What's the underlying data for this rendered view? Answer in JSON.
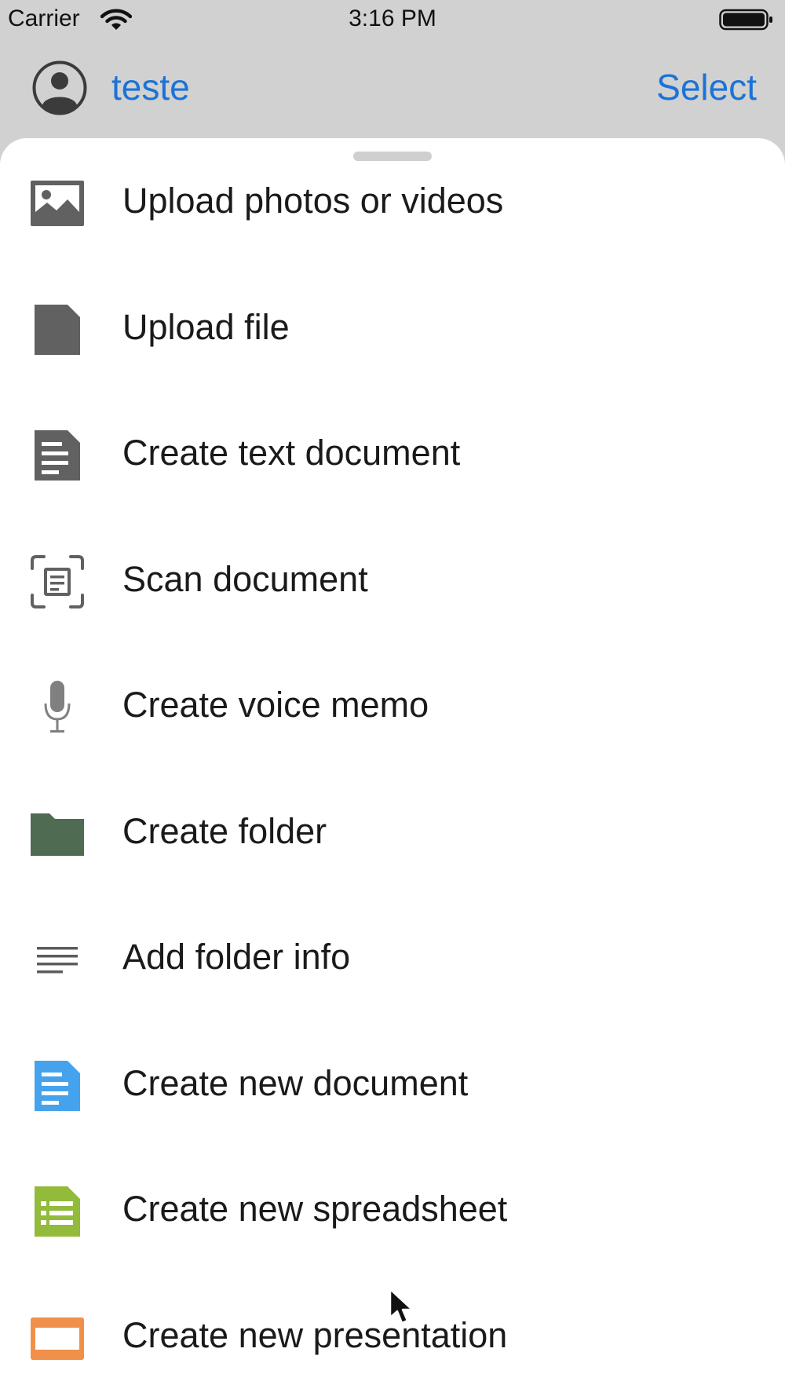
{
  "status_bar": {
    "carrier": "Carrier",
    "time": "3:16 PM",
    "wifi_icon": "wifi-icon",
    "battery_icon": "battery-icon"
  },
  "nav_bar": {
    "avatar_icon": "person-circle-icon",
    "account_name": "teste",
    "select_label": "Select"
  },
  "sheet": {
    "items": [
      {
        "label": "Upload photos or videos",
        "icon": "photo-icon",
        "color": "#616161"
      },
      {
        "label": "Upload file",
        "icon": "file-icon",
        "color": "#616161"
      },
      {
        "label": "Create text document",
        "icon": "text-document-icon",
        "color": "#616161"
      },
      {
        "label": "Scan document",
        "icon": "scan-document-icon",
        "color": "#616161"
      },
      {
        "label": "Create voice memo",
        "icon": "microphone-icon",
        "color": "#808080"
      },
      {
        "label": "Create folder",
        "icon": "folder-icon",
        "color": "#4f6b52"
      },
      {
        "label": "Add folder info",
        "icon": "lines-icon",
        "color": "#5c5c5c"
      },
      {
        "label": "Create new document",
        "icon": "new-document-icon",
        "color": "#45a3ee"
      },
      {
        "label": "Create new spreadsheet",
        "icon": "spreadsheet-icon",
        "color": "#92bb3c"
      },
      {
        "label": "Create new presentation",
        "icon": "presentation-icon",
        "color": "#f0904a"
      }
    ]
  },
  "colors": {
    "accent": "#1b73d8",
    "background": "#d1d1d1",
    "sheet": "#ffffff"
  }
}
